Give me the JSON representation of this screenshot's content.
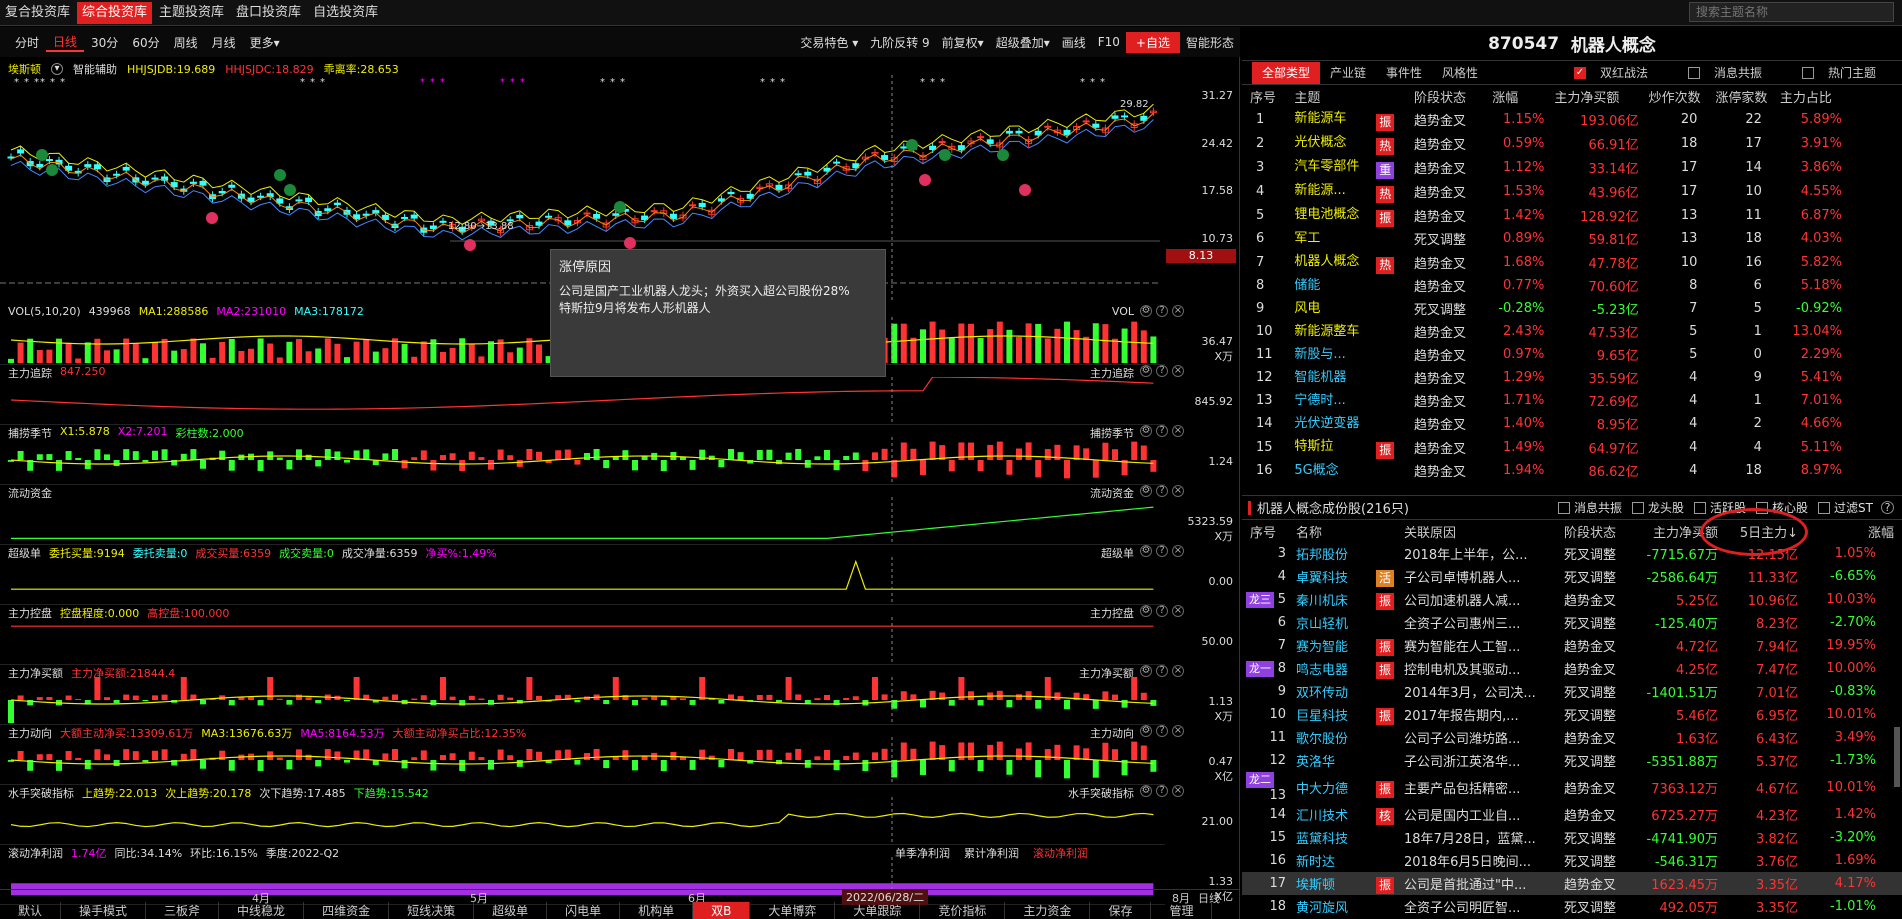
{
  "topnav": {
    "items": [
      "复合投资库",
      "综合投资库",
      "主题投资库",
      "盘口投资库",
      "自选投资库"
    ],
    "active": 1,
    "search_placeholder": "搜索主题名称"
  },
  "toolbar": {
    "periods": [
      "分时",
      "日线",
      "30分",
      "60分",
      "周线",
      "月线",
      "更多▾"
    ],
    "active": 1,
    "right": [
      "交易特色 ▾",
      "九阶反转 9",
      "前复权▾",
      "超级叠加▾",
      "画线",
      "F10"
    ],
    "add_watch": "+自选",
    "smart": "智能形态"
  },
  "main": {
    "name": "埃斯顿",
    "assist": "智能辅助",
    "ind1": "HHJSJDB:19.689",
    "ind2": "HHJSJDC:18.829",
    "ind3": "乖离率:28.653",
    "y": [
      "31.27",
      "24.42",
      "17.58",
      "10.73"
    ],
    "price_tag": "8.13",
    "hi": "29.82",
    "lo": "12.80→13.88"
  },
  "popup": {
    "title": "涨停原因",
    "body": "公司是国产工业机器人龙头；外资买入超公司股份28%\n特斯拉9月将发布人形机器人"
  },
  "panels": [
    {
      "labels": [
        [
          "VOL(5,10,20)",
          "w"
        ],
        [
          "439968",
          "w"
        ],
        [
          "MA1:288586",
          "y"
        ],
        [
          "MA2:231010",
          "p"
        ],
        [
          "MA3:178172",
          "c"
        ]
      ],
      "right": "VOL",
      "ax1": "36.47",
      "ax2": "X万"
    },
    {
      "labels": [
        [
          "主力追踪",
          "w"
        ],
        [
          "847.250",
          "r"
        ]
      ],
      "right": "主力追踪",
      "ax1": "845.92",
      "ax2": ""
    },
    {
      "labels": [
        [
          "捕捞季节",
          "w"
        ],
        [
          "X1:5.878",
          "y"
        ],
        [
          "X2:7.201",
          "p"
        ],
        [
          "彩柱数:2.000",
          "g"
        ]
      ],
      "right": "捕捞季节",
      "ax1": "1.24",
      "ax2": ""
    },
    {
      "labels": [
        [
          "流动资金",
          "w"
        ]
      ],
      "right": "流动资金",
      "ax1": "5323.59",
      "ax2": "X万"
    },
    {
      "labels": [
        [
          "超级单",
          "w"
        ],
        [
          "委托买量:9194",
          "y"
        ],
        [
          "委托卖量:0",
          "c"
        ],
        [
          "成交买量:6359",
          "r"
        ],
        [
          "成交卖量:0",
          "g"
        ],
        [
          "成交净量:6359",
          "w"
        ],
        [
          "净买%:1.49%",
          "p"
        ]
      ],
      "right": "超级单",
      "ax1": "0.00",
      "ax2": ""
    },
    {
      "labels": [
        [
          "主力控盘",
          "w"
        ],
        [
          "控盘程度:0.000",
          "y"
        ],
        [
          "高控盘:100.000",
          "r"
        ]
      ],
      "right": "主力控盘",
      "ax1": "50.00",
      "ax2": ""
    },
    {
      "labels": [
        [
          "主力净买额",
          "w"
        ],
        [
          "主力净买额:21844.4",
          "r"
        ]
      ],
      "right": "主力净买额",
      "ax1": "1.13",
      "ax2": "X万"
    },
    {
      "labels": [
        [
          "主力动向",
          "w"
        ],
        [
          "大额主动净买:13309.61万",
          "r"
        ],
        [
          "MA3:13676.63万",
          "y"
        ],
        [
          "MA5:8164.53万",
          "p"
        ],
        [
          "大额主动净买占比:12.35%",
          "r"
        ]
      ],
      "right": "主力动向",
      "ax1": "0.47",
      "ax2": "X亿"
    },
    {
      "labels": [
        [
          "水手突破指标",
          "w"
        ],
        [
          "上趋势:22.013",
          "y"
        ],
        [
          "次上趋势:20.178",
          "y"
        ],
        [
          "次下趋势:17.485",
          "w"
        ],
        [
          "下趋势:15.542",
          "g"
        ]
      ],
      "right": "水手突破指标",
      "ax1": "21.00",
      "ax2": ""
    },
    {
      "labels": [
        [
          "滚动净利润",
          "w"
        ],
        [
          "1.74亿",
          "p"
        ],
        [
          "同比:34.14%",
          "w"
        ],
        [
          "环比:16.15%",
          "w"
        ],
        [
          "季度:2022-Q2",
          "w"
        ]
      ],
      "right": "",
      "ax1": "1.33",
      "ax2": "X亿"
    }
  ],
  "profit_tabs": [
    "单季净利润",
    "累计净利润",
    "滚动净利润"
  ],
  "xaxis": {
    "labels": [
      "4月",
      "5月",
      "6月",
      "8月"
    ],
    "date": "2022/06/28/二",
    "period": "日线"
  },
  "bottom_tabs": [
    "默认",
    "操手模式",
    "三板斧",
    "中线稳龙",
    "四维资金",
    "短线决策",
    "超级单",
    "闪电单",
    "机构单",
    "双B",
    "大单博弈",
    "大单跟踪",
    "竞价指标",
    "主力资金",
    "保存",
    "管理"
  ],
  "bottom_active": 9,
  "right": {
    "code": "870547",
    "title": "机器人概念",
    "tabs": [
      "全部类型",
      "产业链",
      "事件性",
      "风格性"
    ],
    "tab_active": 0,
    "filters": [
      {
        "label": "双红战法",
        "on": true
      },
      {
        "label": "消息共振",
        "on": false
      },
      {
        "label": "热门主题",
        "on": false
      }
    ],
    "cols": [
      "序号",
      "主题",
      "阶段状态",
      "涨幅",
      "主力净买额",
      "炒作次数",
      "涨停家数",
      "主力占比"
    ],
    "rows": [
      [
        "1",
        "新能源车",
        "振",
        "趋势金叉",
        "1.15%",
        "193.06亿",
        "20",
        "22",
        "5.89%"
      ],
      [
        "2",
        "光伏概念",
        "热",
        "趋势金叉",
        "0.59%",
        "66.91亿",
        "18",
        "17",
        "3.91%"
      ],
      [
        "3",
        "汽车零部件",
        "重",
        "趋势金叉",
        "1.12%",
        "33.14亿",
        "17",
        "14",
        "3.86%"
      ],
      [
        "4",
        "新能源...",
        "热",
        "趋势金叉",
        "1.53%",
        "43.96亿",
        "17",
        "10",
        "4.55%"
      ],
      [
        "5",
        "锂电池概念",
        "振",
        "趋势金叉",
        "1.42%",
        "128.92亿",
        "13",
        "11",
        "6.87%"
      ],
      [
        "6",
        "军工",
        "",
        "死叉调整",
        "0.89%",
        "59.81亿",
        "13",
        "18",
        "4.03%"
      ],
      [
        "7",
        "机器人概念",
        "热",
        "趋势金叉",
        "1.68%",
        "47.78亿",
        "10",
        "16",
        "5.82%"
      ],
      [
        "8",
        "储能",
        "",
        "趋势金叉",
        "0.77%",
        "70.60亿",
        "8",
        "6",
        "5.18%"
      ],
      [
        "9",
        "风电",
        "",
        "死叉调整",
        "-0.28%",
        "-5.23亿",
        "7",
        "5",
        "-0.92%"
      ],
      [
        "10",
        "新能源整车",
        "",
        "趋势金叉",
        "2.43%",
        "47.53亿",
        "5",
        "1",
        "13.04%"
      ],
      [
        "11",
        "新股与...",
        "",
        "趋势金叉",
        "0.97%",
        "9.65亿",
        "5",
        "0",
        "2.29%"
      ],
      [
        "12",
        "智能机器",
        "",
        "趋势金叉",
        "1.29%",
        "35.59亿",
        "4",
        "9",
        "5.41%"
      ],
      [
        "13",
        "宁德时...",
        "",
        "趋势金叉",
        "1.71%",
        "72.69亿",
        "4",
        "1",
        "7.01%"
      ],
      [
        "14",
        "光伏逆变器",
        "",
        "趋势金叉",
        "1.40%",
        "8.95亿",
        "4",
        "2",
        "4.66%"
      ],
      [
        "15",
        "特斯拉",
        "振",
        "趋势金叉",
        "1.49%",
        "64.97亿",
        "4",
        "4",
        "5.11%"
      ],
      [
        "16",
        "5G概念",
        "",
        "趋势金叉",
        "1.94%",
        "86.62亿",
        "4",
        "18",
        "8.97%"
      ]
    ],
    "constituents_title": "机器人概念成份股(216只)",
    "cfilters": [
      {
        "label": "消息共振",
        "on": false
      },
      {
        "label": "龙头股",
        "on": false
      },
      {
        "label": "活跃股",
        "on": false
      },
      {
        "label": "核心股",
        "on": false
      },
      {
        "label": "过滤ST",
        "on": false
      }
    ],
    "ccols": [
      "序号",
      "名称",
      "关联原因",
      "阶段状态",
      "主力净买额",
      "5日主力↓",
      "涨幅"
    ],
    "crows": [
      [
        "3",
        "",
        "拓邦股份",
        "",
        "2018年上半年，公...",
        "死叉调整",
        "-7715.67万",
        "12.15亿",
        "1.05%"
      ],
      [
        "4",
        "",
        "卓翼科技",
        "活",
        "子公司卓博机器人...",
        "死叉调整",
        "-2586.64万",
        "11.33亿",
        "-6.65%"
      ],
      [
        "5",
        "龙三",
        "秦川机床",
        "振",
        "公司加速机器人减...",
        "趋势金叉",
        "5.25亿",
        "10.96亿",
        "10.03%"
      ],
      [
        "6",
        "",
        "京山轻机",
        "",
        "全资子公司惠州三...",
        "死叉调整",
        "-125.40万",
        "8.23亿",
        "-2.70%"
      ],
      [
        "7",
        "",
        "赛为智能",
        "振",
        "赛为智能在人工智...",
        "趋势金叉",
        "4.72亿",
        "7.94亿",
        "19.95%"
      ],
      [
        "8",
        "龙一",
        "鸣志电器",
        "振",
        "控制电机及其驱动...",
        "趋势金叉",
        "4.25亿",
        "7.47亿",
        "10.00%"
      ],
      [
        "9",
        "",
        "双环传动",
        "",
        "2014年3月，公司决...",
        "死叉调整",
        "-1401.51万",
        "7.01亿",
        "-0.83%"
      ],
      [
        "10",
        "",
        "巨星科技",
        "振",
        "2017年报告期内,...",
        "死叉调整",
        "5.46亿",
        "6.95亿",
        "10.01%"
      ],
      [
        "11",
        "",
        "歌尔股份",
        "",
        "公司子公司潍坊路...",
        "趋势金叉",
        "1.63亿",
        "6.43亿",
        "3.49%"
      ],
      [
        "12",
        "",
        "英洛华",
        "",
        "子公司浙江英洛华...",
        "死叉调整",
        "-5351.88万",
        "5.37亿",
        "-1.73%"
      ],
      [
        "13",
        "龙二",
        "中大力德",
        "振",
        "主要产品包括精密...",
        "趋势金叉",
        "7363.12万",
        "4.67亿",
        "10.01%"
      ],
      [
        "14",
        "",
        "汇川技术",
        "核",
        "公司是国内工业自...",
        "趋势金叉",
        "6725.27万",
        "4.23亿",
        "1.42%"
      ],
      [
        "15",
        "",
        "蓝黛科技",
        "",
        "18年7月28日，蓝黛...",
        "死叉调整",
        "-4741.90万",
        "3.82亿",
        "-3.20%"
      ],
      [
        "16",
        "",
        "新时达",
        "",
        "2018年6月5日晚间...",
        "死叉调整",
        "-546.31万",
        "3.76亿",
        "1.69%"
      ],
      [
        "17",
        "",
        "埃斯顿",
        "振",
        "公司是首批通过\"中...",
        "趋势金叉",
        "1623.45万",
        "3.35亿",
        "4.17%"
      ],
      [
        "18",
        "",
        "黄河旋风",
        "",
        "全资子公司明匠智...",
        "死叉调整",
        "492.05万",
        "3.35亿",
        "-1.01%"
      ]
    ]
  },
  "colors": {
    "accent": "#e02020",
    "up": "#ff3333",
    "down": "#33ff33"
  }
}
